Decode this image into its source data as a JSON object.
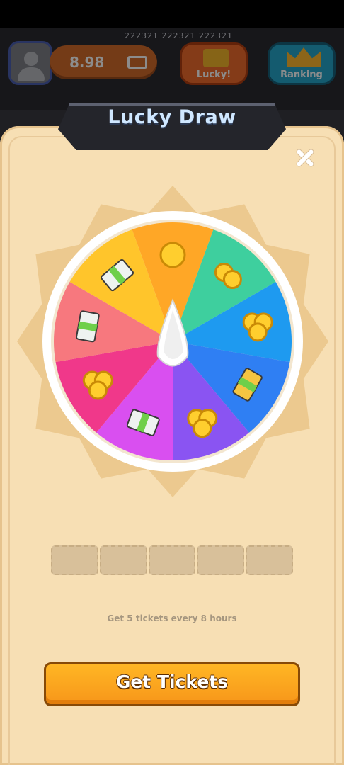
{
  "header": {
    "ids": "222321  222321  222321",
    "balance": "8.98",
    "lucky_label": "Lucky!",
    "ranking_label": "Ranking"
  },
  "modal": {
    "title": "Lucky Draw",
    "ticket_slots": 5,
    "info": "Get 5 tickets every 8 hours",
    "cta_label": "Get Tickets"
  },
  "wheel": {
    "segments": [
      {
        "prize": "coin",
        "color": "#ffa726"
      },
      {
        "prize": "coins",
        "color": "#3ecf9e"
      },
      {
        "prize": "coins-pile",
        "color": "#1e9af0"
      },
      {
        "prize": "ticket-cash",
        "color": "#2f7ff3"
      },
      {
        "prize": "coins-pile",
        "color": "#8a54f2"
      },
      {
        "prize": "cash-100",
        "color": "#d94ff0"
      },
      {
        "prize": "coins-pile",
        "color": "#f0388a"
      },
      {
        "prize": "cash-10x",
        "color": "#f7787e"
      },
      {
        "prize": "cash-100",
        "color": "#ffc52b"
      }
    ]
  }
}
